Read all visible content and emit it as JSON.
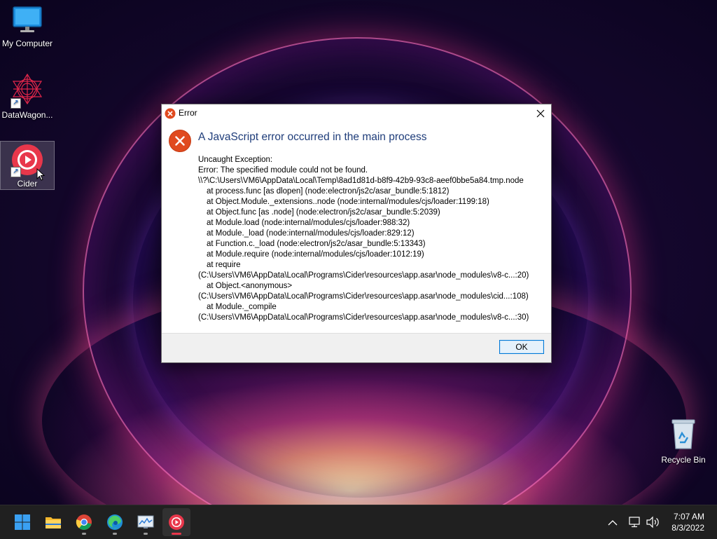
{
  "desktop": {
    "icons": [
      {
        "label": "My Computer"
      },
      {
        "label": "DataWagon..."
      },
      {
        "label": "Cider"
      },
      {
        "label": "Recycle Bin"
      }
    ]
  },
  "dialog": {
    "title": "Error",
    "heading": "A JavaScript error occurred in the main process",
    "lines": [
      {
        "text": "Uncaught Exception:",
        "indent": false
      },
      {
        "text": "Error: The specified module could not be found.",
        "indent": false
      },
      {
        "text": "\\\\?\\C:\\Users\\VM6\\AppData\\Local\\Temp\\8ad1d81d-b8f9-42b9-93c8-aeef0bbe5a84.tmp.node",
        "indent": false
      },
      {
        "text": "at process.func [as dlopen] (node:electron/js2c/asar_bundle:5:1812)",
        "indent": true
      },
      {
        "text": "at Object.Module._extensions..node (node:internal/modules/cjs/loader:1199:18)",
        "indent": true
      },
      {
        "text": "at Object.func [as .node] (node:electron/js2c/asar_bundle:5:2039)",
        "indent": true
      },
      {
        "text": "at Module.load (node:internal/modules/cjs/loader:988:32)",
        "indent": true
      },
      {
        "text": "at Module._load (node:internal/modules/cjs/loader:829:12)",
        "indent": true
      },
      {
        "text": "at Function.c._load (node:electron/js2c/asar_bundle:5:13343)",
        "indent": true
      },
      {
        "text": "at Module.require (node:internal/modules/cjs/loader:1012:19)",
        "indent": true
      },
      {
        "text": "at require",
        "indent": true
      },
      {
        "text": "(C:\\Users\\VM6\\AppData\\Local\\Programs\\Cider\\resources\\app.asar\\node_modules\\v8-c...:20)",
        "indent": false
      },
      {
        "text": "at Object.<anonymous>",
        "indent": true
      },
      {
        "text": "(C:\\Users\\VM6\\AppData\\Local\\Programs\\Cider\\resources\\app.asar\\node_modules\\cid...:108)",
        "indent": false
      },
      {
        "text": "at Module._compile",
        "indent": true
      },
      {
        "text": "(C:\\Users\\VM6\\AppData\\Local\\Programs\\Cider\\resources\\app.asar\\node_modules\\v8-c...:30)",
        "indent": false
      }
    ],
    "ok_label": "OK"
  },
  "taskbar": {
    "apps": [
      {
        "name": "start",
        "icon": "windows-logo-icon"
      },
      {
        "name": "file-explorer",
        "icon": "folder-icon"
      },
      {
        "name": "chrome",
        "icon": "chrome-icon"
      },
      {
        "name": "edge",
        "icon": "edge-icon"
      },
      {
        "name": "performance-monitor",
        "icon": "monitor-chart-icon"
      },
      {
        "name": "cider",
        "icon": "cider-icon",
        "active": true
      }
    ],
    "clock": {
      "time": "7:07 AM",
      "date": "8/3/2022"
    }
  },
  "colors": {
    "taskbar_bg": "#202020",
    "dialog_heading": "#1f3d7a",
    "error_red": "#e04a1f",
    "cider_red": "#e8374b",
    "button_border": "#0078d7"
  }
}
